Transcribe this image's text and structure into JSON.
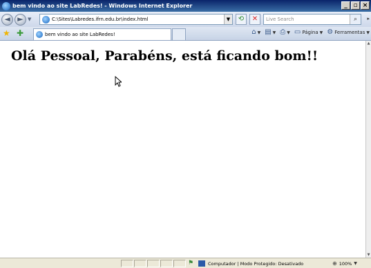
{
  "window": {
    "title": "bem vindo ao site LabRedes! - Windows Internet Explorer",
    "controls": [
      "_",
      "▫",
      "×"
    ]
  },
  "navigation": {
    "back_glyph": "◄",
    "forward_glyph": "►",
    "address_url": "C:\\Sites\\Labredes.ifrn.edu.br\\index.html",
    "search_placeholder": "Live Search"
  },
  "tabs": [
    {
      "label": "bem vindo ao site LabRedes!",
      "active": true
    }
  ],
  "toolbar": {
    "home_icon": "home-icon",
    "page_label": "Página",
    "tools_label": "Ferramentas"
  },
  "page": {
    "heading": "Olá Pessoal, Parabéns, está ficando bom!!"
  },
  "status": {
    "zone_text": "Computador | Modo Protegido: Desativado",
    "zoom_text": "100%"
  },
  "colors": {
    "title_bar": "#0a246a",
    "content_bg": "#ffffff",
    "status_bg": "#ece9d8"
  }
}
